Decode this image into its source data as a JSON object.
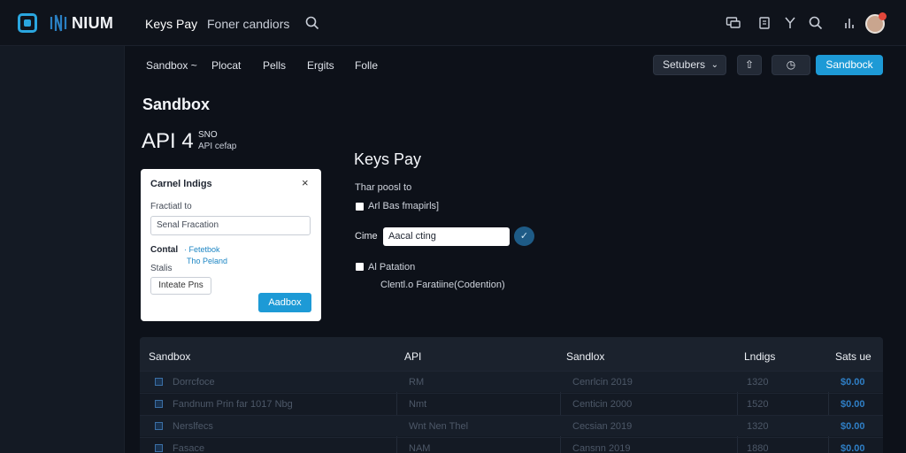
{
  "app": {
    "brand": "NIUM",
    "tabs": [
      {
        "label": "Keys Pay",
        "active": true
      },
      {
        "label": "Foner candiors",
        "active": false
      }
    ],
    "accent": "#1d9ad6"
  },
  "subnav": {
    "items": [
      "Sandbox ~",
      "Plocat",
      "Pells",
      "Ergits",
      "Folle"
    ],
    "filter_label": "Setubers",
    "primary_button": "Sandbock"
  },
  "header": {
    "title": "Sandbox",
    "api_label": "API 4",
    "api_sup": "SNO",
    "api_sub": "API cefap"
  },
  "card": {
    "title": "Carnel lndigs",
    "field1_label": "Fractiatl to",
    "field1_value": "Senal Fracation",
    "contact_label": "Contal",
    "link1": "· Fetetbok",
    "link2": "Tho Peland",
    "field3_label": "Stalis",
    "field3_value": "Inteate Pns",
    "button": "Aadbox"
  },
  "form": {
    "title": "Keys Pay",
    "intro": "Thar poosl to",
    "check1_label": "Arl Bas fmapirls]",
    "input_label": "Cime",
    "input_value": "Aacal cting",
    "check2_label": "Al Patation",
    "note": "Clentl.o Faratiine(Codention)"
  },
  "table": {
    "headers": [
      "Sandbox",
      "API",
      "Sandlox",
      "Lndigs",
      "Sats ue"
    ],
    "rows": [
      {
        "name": "Dorrcfoce",
        "api": "RM",
        "sandbox": "Cenrlcin 2019",
        "lndigs": "1320",
        "value": "$0.00"
      },
      {
        "name": "Fandnum Prin far 1017 Nbg",
        "api": "Nmt",
        "sandbox": "Centicin 2000",
        "lndigs": "1520",
        "value": "$0.00"
      },
      {
        "name": "Nerslfecs",
        "api": "Wnt Nen Thel",
        "sandbox": "Cecsian 2019",
        "lndigs": "1320",
        "value": "$0.00"
      },
      {
        "name": "Fasace",
        "api": "NAM",
        "sandbox": "Cansnn 2019",
        "lndigs": "1880",
        "value": "$0.00"
      }
    ]
  }
}
